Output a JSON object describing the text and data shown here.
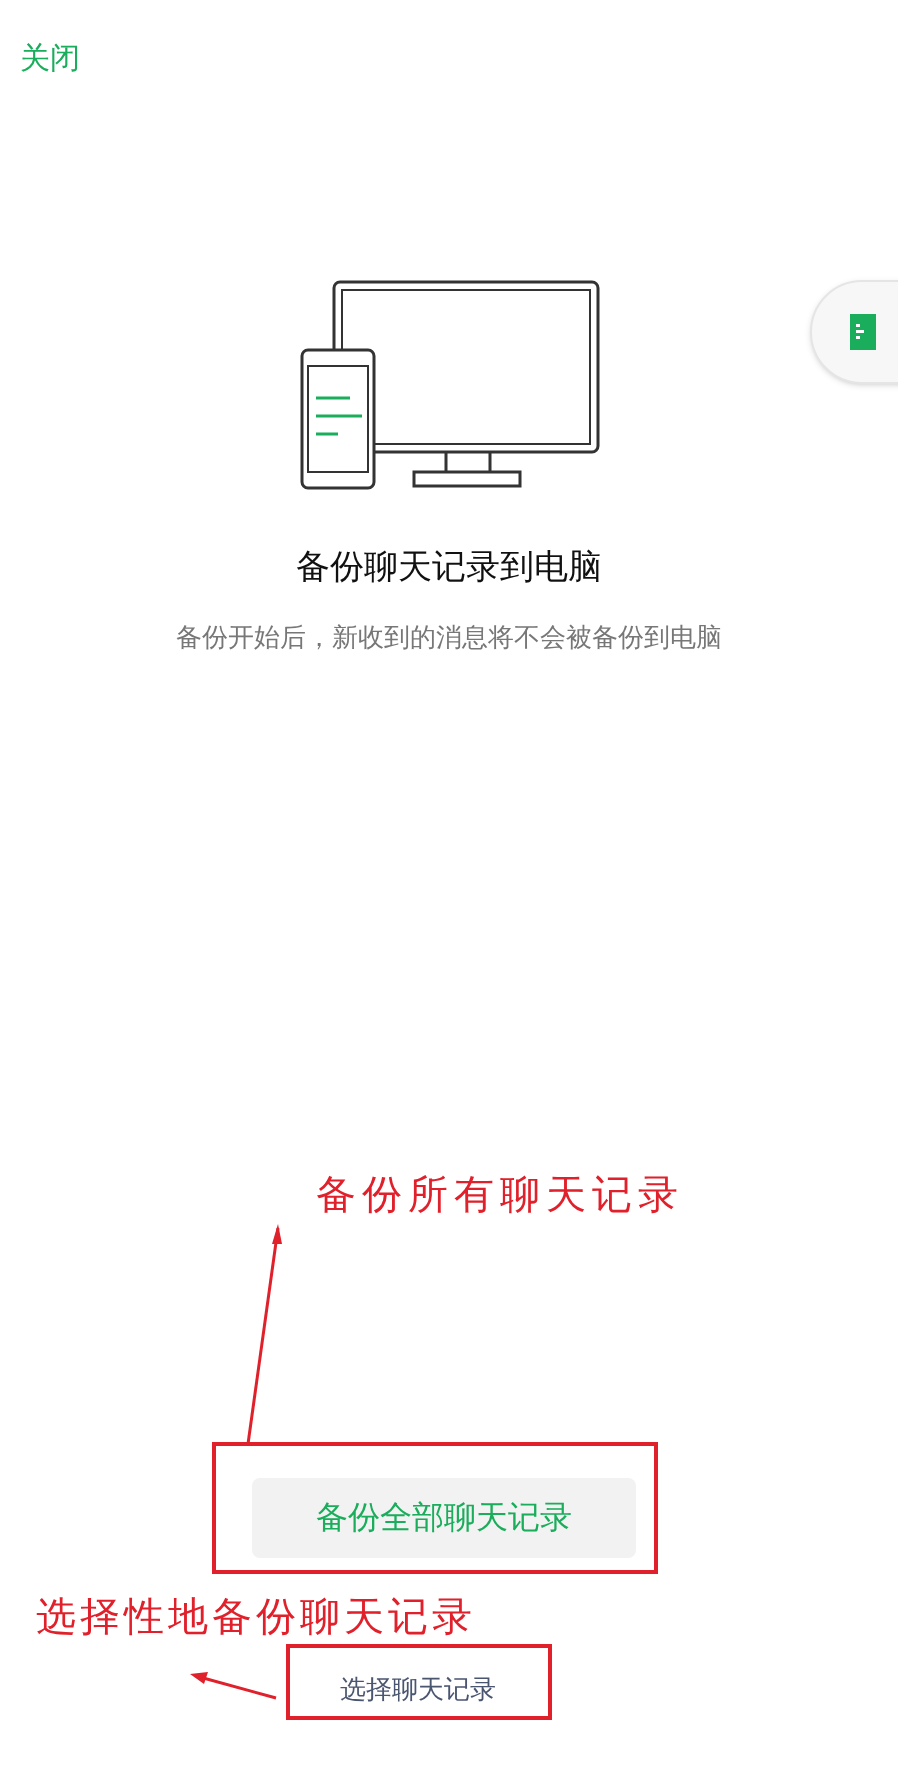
{
  "close_link": "关闭",
  "title": "备份聊天记录到电脑",
  "subtitle": "备份开始后，新收到的消息将不会被备份到电脑",
  "primary_button": "备份全部聊天记录",
  "secondary_link": "选择聊天记录",
  "annotations": [
    {
      "text": "备份所有聊天记录"
    },
    {
      "text": "选择性地备份聊天记录"
    }
  ]
}
